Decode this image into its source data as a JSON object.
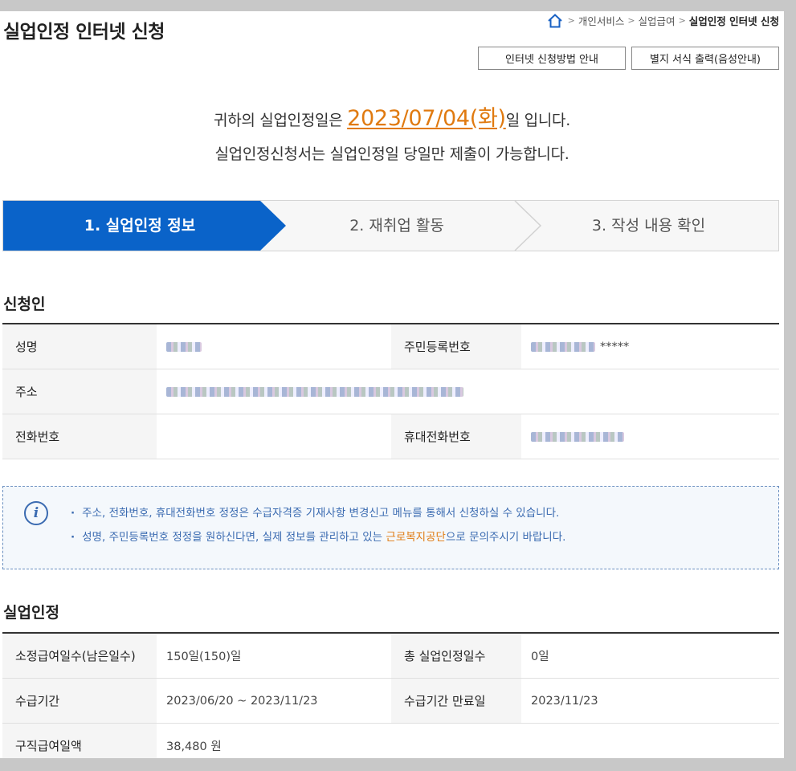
{
  "page": {
    "title": "실업인정 인터넷 신청"
  },
  "breadcrumb": {
    "items": [
      "개인서비스",
      "실업급여"
    ],
    "current": "실업인정 인터넷 신청",
    "separator": ">"
  },
  "buttons": {
    "guide": "인터넷 신청방법 안내",
    "print": "별지 서식 출력(음성안내)"
  },
  "notice": {
    "line1_prefix": "귀하의 실업인정일은 ",
    "date": "2023/07/04(화)",
    "line1_suffix": "일 입니다.",
    "line2": "실업인정신청서는 실업인정일 당일만 제출이 가능합니다."
  },
  "steps": [
    {
      "label": "1. 실업인정 정보",
      "active": true
    },
    {
      "label": "2. 재취업 활동",
      "active": false
    },
    {
      "label": "3. 작성 내용 확인",
      "active": false
    }
  ],
  "applicant": {
    "section_title": "신청인",
    "name_label": "성명",
    "rrn_label": "주민등록번호",
    "rrn_suffix": "*****",
    "address_label": "주소",
    "phone_label": "전화번호",
    "phone_value": "",
    "mobile_label": "휴대전화번호"
  },
  "info": {
    "line1": "주소, 전화번호, 휴대전화번호 정정은 수급자격증 기재사항 변경신고 메뉴를 통해서 신청하실 수 있습니다.",
    "line2_prefix": "성명, 주민등록번호 정정을 원하신다면, 실제 정보를 관리하고 있는 ",
    "line2_highlight": "근로복지공단",
    "line2_suffix": "으로 문의주시기 바랍니다."
  },
  "unemployment": {
    "section_title": "실업인정",
    "days_label": "소정급여일수(남은일수)",
    "days_value": "150일(150)일",
    "total_label": "총 실업인정일수",
    "total_value": "0일",
    "period_label": "수급기간",
    "period_value": "2023/06/20 ~ 2023/11/23",
    "expiry_label": "수급기간 만료일",
    "expiry_value": "2023/11/23",
    "daily_label": "구직급여일액",
    "daily_value": "38,480 원"
  },
  "colors": {
    "active_step": "#0a63c9",
    "accent_orange": "#e07a10",
    "info_blue": "#3b6bb1"
  }
}
